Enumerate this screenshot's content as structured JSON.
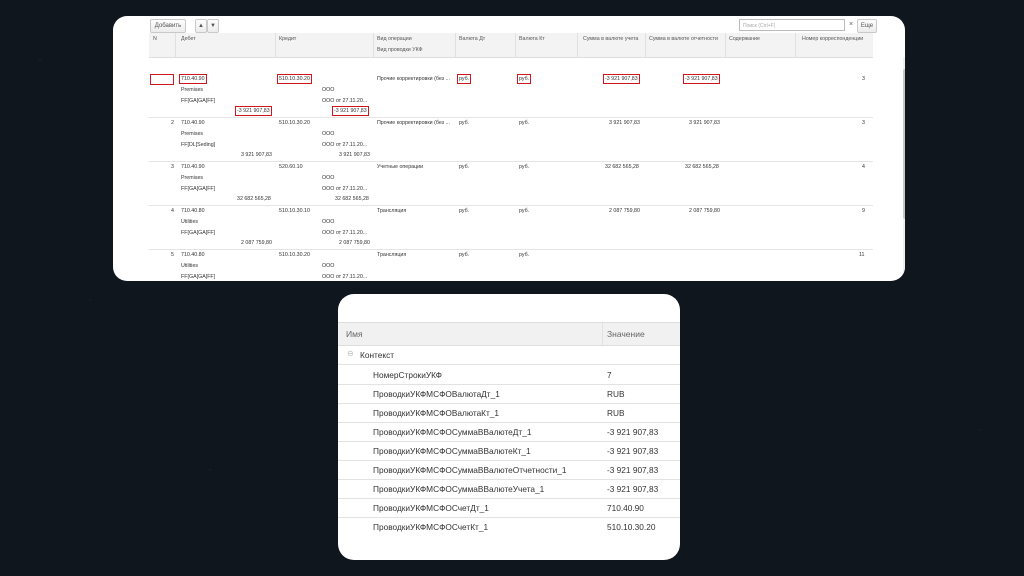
{
  "toolbar": {
    "add_label": "Добавить",
    "up_icon": "arrow-up-icon",
    "down_icon": "arrow-down-icon",
    "search_placeholder": "Поиск (Ctrl+F)",
    "clear_label": "×",
    "more_label": "Еще"
  },
  "grid": {
    "columns": {
      "n": "N",
      "debit": "Дебет",
      "credit": "Кредит",
      "op_type": "Вид операции",
      "op_type_sub": "Вид проводки УКФ",
      "cur_dt": "Валюта Дт",
      "cur_kt": "Валюта Кт",
      "sum_acc": "Сумма в валюте учета",
      "sum_rep": "Сумма в валюте отчетности",
      "content": "Содержание",
      "corr_no": "Номер корреспонденции"
    },
    "rows": [
      {
        "n": "",
        "debit": "710.40.90",
        "debit2": "Premises",
        "debit3": "FF[GA[GA[FF]",
        "debit_sum": "-3 921 907,83",
        "credit": "510.10.30.20",
        "credit2": "ООО",
        "credit3": "",
        "credit_sum": "-3 921 907,83",
        "op": "Прочие корректировки (без ...",
        "cur_dt": "руб.",
        "cur_kt": "руб.",
        "sum_acc": "-3 921 907,83",
        "sum_rep": "-3 921 907,83",
        "corr": "3"
      },
      {
        "n": "2",
        "debit": "710.40.90",
        "debit2": "Premises",
        "debit3": "FF[DL[Seding]",
        "debit_sum": "3 921 907,83",
        "credit": "510.10.30.20",
        "credit2": "ООО",
        "credit3": "ООО от 27.11.20...",
        "credit_sum": "3 921 907,83",
        "op": "Прочие корректировки (без ...",
        "cur_dt": "руб.",
        "cur_kt": "руб.",
        "sum_acc": "3 921 907,83",
        "sum_rep": "3 921 907,83",
        "corr": "3"
      },
      {
        "n": "3",
        "debit": "710.40.90",
        "debit2": "Premises",
        "debit3": "FF[GA[GA[FF]",
        "debit_sum": "32 682 565,28",
        "credit": "520.60.10",
        "credit2": "ООО",
        "credit3": "ООО от 27.11.20...",
        "credit_sum": "32 682 565,28",
        "op": "Учетные операции",
        "cur_dt": "руб.",
        "cur_kt": "руб.",
        "sum_acc": "32 682 565,28",
        "sum_rep": "32 682 565,28",
        "corr": "4"
      },
      {
        "n": "4",
        "debit": "710.40.80",
        "debit2": "Utilities",
        "debit3": "FF[GA[GA[FF]",
        "debit_sum": "2 087 759,80",
        "credit": "510.10.30.10",
        "credit2": "ООО",
        "credit3": "ООО от 27.11.20...",
        "credit_sum": "2 087 759,80",
        "op": "Трансляция",
        "cur_dt": "руб.",
        "cur_kt": "руб.",
        "sum_acc": "2 087 759,80",
        "sum_rep": "2 087 759,80",
        "corr": "9"
      },
      {
        "n": "5",
        "debit": "710.40.80",
        "debit2": "Utilities",
        "debit3": "FF[GA[GA[FF]",
        "debit_sum": "",
        "credit": "510.10.30.20",
        "credit2": "ООО",
        "credit3": "ООО от 27.11.20...",
        "credit_sum": "",
        "op": "Трансляция",
        "cur_dt": "руб.",
        "cur_kt": "руб.",
        "sum_acc": "",
        "sum_rep": "",
        "corr": "11"
      }
    ],
    "row1_credit3": "ООО от 27.11.20..."
  },
  "props": {
    "col_name": "Имя",
    "col_value": "Значение",
    "group_label": "Контекст",
    "items": [
      {
        "name": "НомерСтрокиУКФ",
        "value": "7"
      },
      {
        "name": "ПроводкиУКФМСФОВалютаДт_1",
        "value": "RUB"
      },
      {
        "name": "ПроводкиУКФМСФОВалютаКт_1",
        "value": "RUB"
      },
      {
        "name": "ПроводкиУКФМСФОСуммаВВалютеДт_1",
        "value": "-3 921 907,83"
      },
      {
        "name": "ПроводкиУКФМСФОСуммаВВалютеКт_1",
        "value": "-3 921 907,83"
      },
      {
        "name": "ПроводкиУКФМСФОСуммаВВалютеОтчетности_1",
        "value": "-3 921 907,83"
      },
      {
        "name": "ПроводкиУКФМСФОСуммаВВалютеУчета_1",
        "value": "-3 921 907,83"
      },
      {
        "name": "ПроводкиУКФМСФОСчетДт_1",
        "value": "710.40.90"
      },
      {
        "name": "ПроводкиУКФМСФОСчетКт_1",
        "value": "510.10.30.20"
      }
    ]
  },
  "colors": {
    "highlight": "#d0161a",
    "background": "#0f161d"
  }
}
